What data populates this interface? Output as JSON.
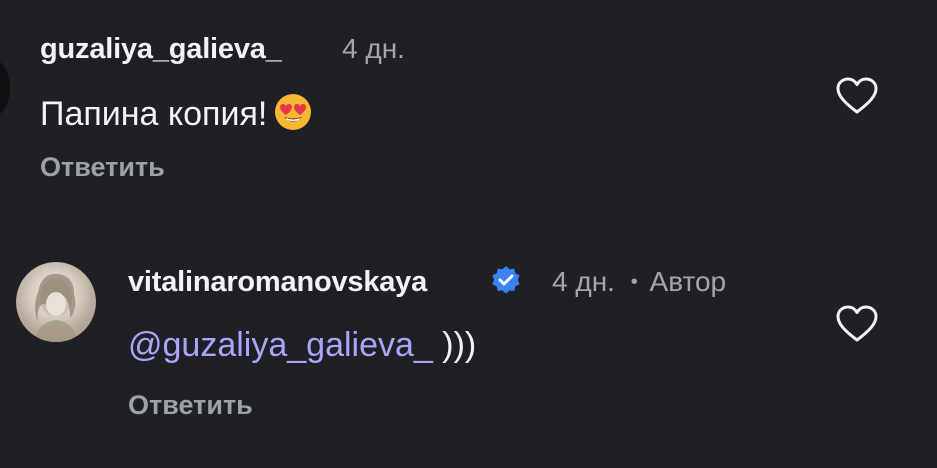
{
  "comments": [
    {
      "username": "guzaliya_galieva_",
      "time": "4 дн.",
      "text": "Папина копия!",
      "emoji": "heart-eyes-emoji",
      "reply_label": "Ответить"
    },
    {
      "username": "vitalinaromanovskaya",
      "time": "4 дн.",
      "separator": "•",
      "author_label": "Автор",
      "mention": "@guzaliya_galieva_",
      "text_after": ")))",
      "reply_label": "Ответить"
    }
  ],
  "colors": {
    "background": "#1f2024",
    "primary_text": "#f2f3f5",
    "secondary_text": "#a3a6ad",
    "mention": "#a8a6ff",
    "verified": "#3b82f6"
  }
}
